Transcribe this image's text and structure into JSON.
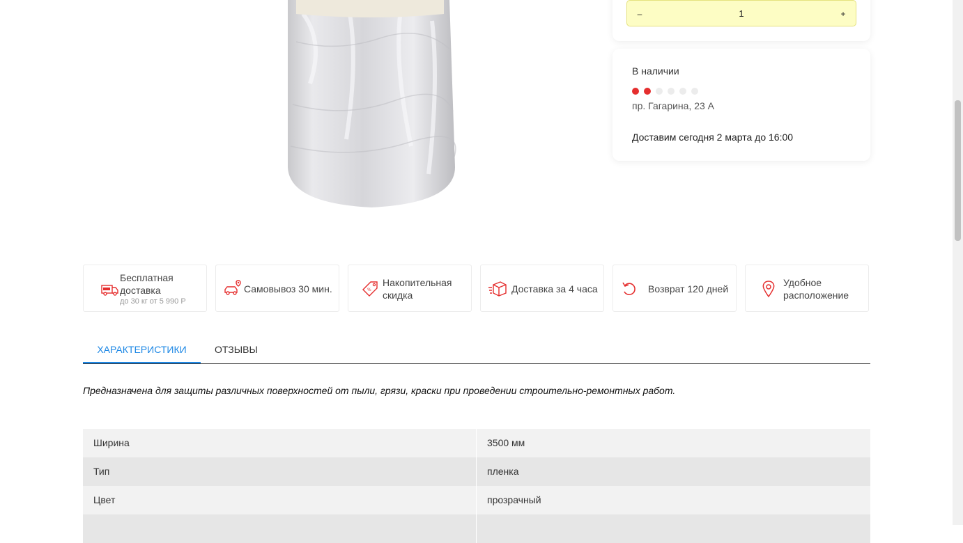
{
  "quantity": {
    "minus": "–",
    "value": "1",
    "plus": "+"
  },
  "stock": {
    "title": "В наличии",
    "level": {
      "filled": 2,
      "total": 6
    },
    "address": "пр. Гагарина, 23 А",
    "delivery": "Доставим сегодня 2 марта до 16:00"
  },
  "features": [
    {
      "icon": "free-delivery-truck-icon",
      "title": "Бесплатная доставка",
      "subtitle": "до 30 кг от 5 990 Р"
    },
    {
      "icon": "car-pickup-icon",
      "title": "Самовывоз 30 мин."
    },
    {
      "icon": "discount-tag-icon",
      "title": "Накопительная скидка"
    },
    {
      "icon": "package-icon",
      "title": "Доставка за 4 часа"
    },
    {
      "icon": "return-arrow-icon",
      "title": "Возврат 120 дней"
    },
    {
      "icon": "location-pin-icon",
      "title": "Удобное расположение"
    }
  ],
  "tabs": [
    {
      "label": "ХАРАКТЕРИСТИКИ"
    },
    {
      "label": "ОТЗЫВЫ"
    }
  ],
  "description": "Предназначена для защиты различных поверхностей от пыли, грязи, краски при проведении строительно-ремонтных работ.",
  "specs": [
    {
      "label": "Ширина",
      "value": "3500 мм"
    },
    {
      "label": "Тип",
      "value": "пленка"
    },
    {
      "label": "Цвет",
      "value": "прозрачный"
    },
    {
      "label": "",
      "value": ""
    }
  ],
  "colors": {
    "accent": "#1e88e5",
    "stock_dot": "#e52e2e",
    "icon_red": "#e52e2e",
    "qty_bg": "#fdfdc4"
  }
}
